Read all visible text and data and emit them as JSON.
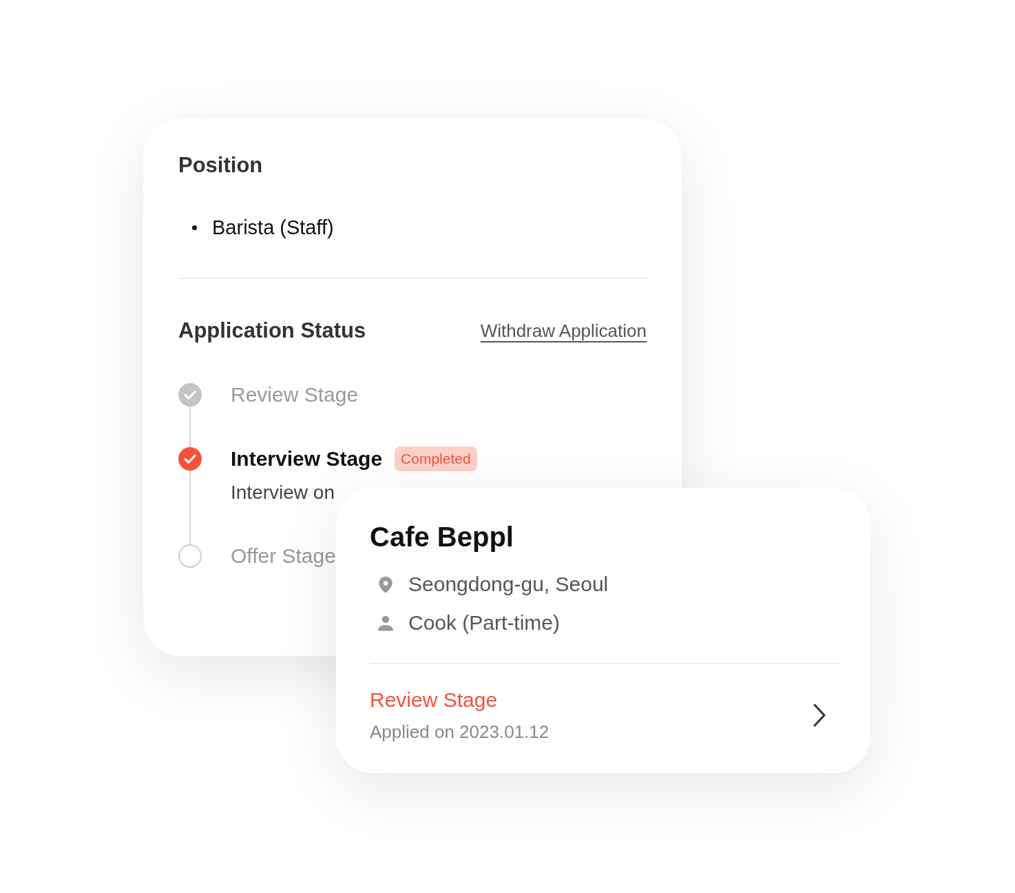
{
  "position": {
    "title": "Position",
    "items": [
      "Barista (Staff)"
    ]
  },
  "application_status": {
    "title": "Application Status",
    "withdraw_link": "Withdraw Application",
    "stages": [
      {
        "name": "Review Stage",
        "kind": "done"
      },
      {
        "name": "Interview Stage",
        "kind": "current",
        "badge": "Completed",
        "detail": "Interview on"
      },
      {
        "name": "Offer Stage",
        "kind": "pending"
      }
    ]
  },
  "job_card": {
    "company": "Cafe Beppl",
    "details": [
      {
        "kind": "location",
        "text": "Seongdong-gu, Seoul"
      },
      {
        "kind": "role",
        "text": "Cook (Part-time)"
      }
    ],
    "stage": "Review Stage",
    "applied": "Applied on 2023.01.12"
  }
}
